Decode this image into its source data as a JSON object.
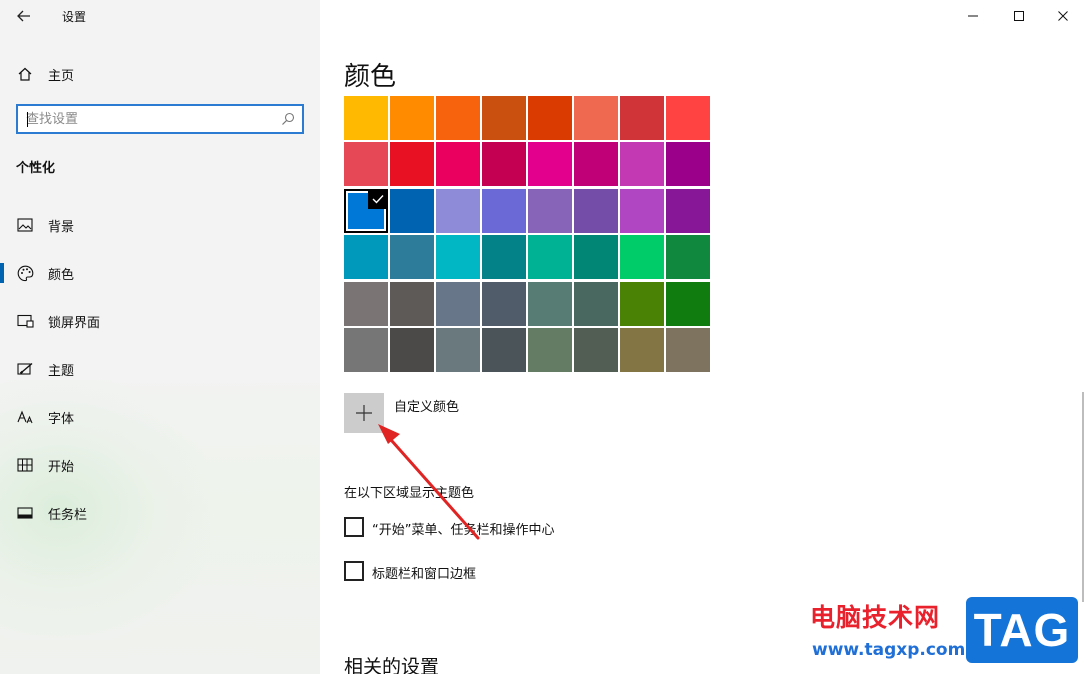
{
  "window": {
    "title": "设置",
    "controls": {
      "minimize": "—",
      "maximize": "☐",
      "close": "✕"
    }
  },
  "sidebar": {
    "home_label": "主页",
    "search_placeholder": "查找设置",
    "section_title": "个性化",
    "items": [
      {
        "label": "背景",
        "icon": "picture-icon",
        "active": false
      },
      {
        "label": "颜色",
        "icon": "palette-icon",
        "active": true
      },
      {
        "label": "锁屏界面",
        "icon": "lock-screen-icon",
        "active": false
      },
      {
        "label": "主题",
        "icon": "theme-brush-icon",
        "active": false
      },
      {
        "label": "字体",
        "icon": "font-icon",
        "active": false
      },
      {
        "label": "开始",
        "icon": "start-grid-icon",
        "active": false
      },
      {
        "label": "任务栏",
        "icon": "taskbar-icon",
        "active": false
      }
    ]
  },
  "main": {
    "title": "颜色",
    "selected_swatch": "#0078d7",
    "swatches": [
      [
        "#ffb900",
        "#ff8c00",
        "#f7630c",
        "#ca5010",
        "#da3b01",
        "#ef6950",
        "#d13438",
        "#ff4343"
      ],
      [
        "#e74856",
        "#e81123",
        "#ea005e",
        "#c30052",
        "#e3008c",
        "#bf0077",
        "#c239b3",
        "#9a0089"
      ],
      [
        "#0078d7",
        "#0063b1",
        "#8e8cd8",
        "#6b69d6",
        "#8764b8",
        "#744da9",
        "#b146c2",
        "#881798"
      ],
      [
        "#0099bc",
        "#2d7d9a",
        "#00b7c3",
        "#038387",
        "#00b294",
        "#018574",
        "#00cc6a",
        "#10893e"
      ],
      [
        "#7a7574",
        "#5d5a58",
        "#68768a",
        "#515c6b",
        "#567c73",
        "#486860",
        "#498205",
        "#107c10"
      ],
      [
        "#767676",
        "#4c4a48",
        "#69797e",
        "#4a5459",
        "#647c64",
        "#525e54",
        "#847545",
        "#7e735f"
      ]
    ],
    "custom_color_label": "自定义颜色",
    "show_accent_label": "在以下区域显示主题色",
    "checkbox_start": "“开始”菜单、任务栏和操作中心",
    "checkbox_title_bars": "标题栏和窗口边框",
    "related_settings": "相关的设置"
  },
  "watermark": {
    "text": "电脑技术网",
    "url": "www.tagxp.com",
    "badge": "TAG"
  }
}
